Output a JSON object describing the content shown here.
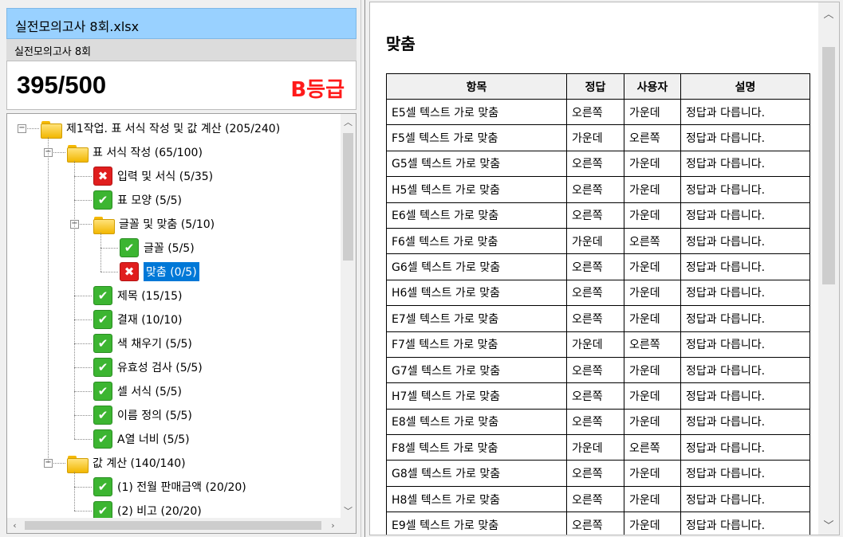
{
  "header": {
    "file_name": "실전모의고사 8회.xlsx",
    "exam_name": "실전모의고사 8회",
    "score": "395/500",
    "grade": "B등급"
  },
  "tree": [
    {
      "label": "제1작업. 표 서식 작성 및 값 계산 (205/240)",
      "icon": "folder-icon",
      "level": 0,
      "expander": "−"
    },
    {
      "label": "표 서식 작성 (65/100)",
      "icon": "folder-icon",
      "level": 1,
      "expander": "−"
    },
    {
      "label": "입력 및 서식 (5/35)",
      "icon": "fail-icon",
      "level": 2
    },
    {
      "label": "표 모양 (5/5)",
      "icon": "pass-icon",
      "level": 2
    },
    {
      "label": "글꼴 및 맞춤 (5/10)",
      "icon": "folder-icon",
      "level": 2,
      "expander": "−"
    },
    {
      "label": "글꼴 (5/5)",
      "icon": "pass-icon",
      "level": 3
    },
    {
      "label": "맞춤 (0/5)",
      "icon": "fail-icon",
      "level": 3,
      "selected": true
    },
    {
      "label": "제목 (15/15)",
      "icon": "pass-icon",
      "level": 2
    },
    {
      "label": "결재 (10/10)",
      "icon": "pass-icon",
      "level": 2
    },
    {
      "label": "색 채우기 (5/5)",
      "icon": "pass-icon",
      "level": 2
    },
    {
      "label": "유효성 검사 (5/5)",
      "icon": "pass-icon",
      "level": 2
    },
    {
      "label": "셀 서식 (5/5)",
      "icon": "pass-icon",
      "level": 2
    },
    {
      "label": "이름 정의 (5/5)",
      "icon": "pass-icon",
      "level": 2
    },
    {
      "label": "A열 너비 (5/5)",
      "icon": "pass-icon",
      "level": 2
    },
    {
      "label": "값 계산 (140/140)",
      "icon": "folder-icon",
      "level": 1,
      "expander": "−"
    },
    {
      "label": "(1) 전월 판매금액 (20/20)",
      "icon": "pass-icon",
      "level": 2
    },
    {
      "label": "(2) 비고 (20/20)",
      "icon": "pass-icon",
      "level": 2
    }
  ],
  "detail": {
    "title": "맞춤",
    "columns": [
      "항목",
      "정답",
      "사용자",
      "설명"
    ],
    "rows": [
      [
        "E5셀 텍스트 가로 맞춤",
        "오른쪽",
        "가운데",
        "정답과 다릅니다."
      ],
      [
        "F5셀 텍스트 가로 맞춤",
        "가운데",
        "오른쪽",
        "정답과 다릅니다."
      ],
      [
        "G5셀 텍스트 가로 맞춤",
        "오른쪽",
        "가운데",
        "정답과 다릅니다."
      ],
      [
        "H5셀 텍스트 가로 맞춤",
        "오른쪽",
        "가운데",
        "정답과 다릅니다."
      ],
      [
        "E6셀 텍스트 가로 맞춤",
        "오른쪽",
        "가운데",
        "정답과 다릅니다."
      ],
      [
        "F6셀 텍스트 가로 맞춤",
        "가운데",
        "오른쪽",
        "정답과 다릅니다."
      ],
      [
        "G6셀 텍스트 가로 맞춤",
        "오른쪽",
        "가운데",
        "정답과 다릅니다."
      ],
      [
        "H6셀 텍스트 가로 맞춤",
        "오른쪽",
        "가운데",
        "정답과 다릅니다."
      ],
      [
        "E7셀 텍스트 가로 맞춤",
        "오른쪽",
        "가운데",
        "정답과 다릅니다."
      ],
      [
        "F7셀 텍스트 가로 맞춤",
        "가운데",
        "오른쪽",
        "정답과 다릅니다."
      ],
      [
        "G7셀 텍스트 가로 맞춤",
        "오른쪽",
        "가운데",
        "정답과 다릅니다."
      ],
      [
        "H7셀 텍스트 가로 맞춤",
        "오른쪽",
        "가운데",
        "정답과 다릅니다."
      ],
      [
        "E8셀 텍스트 가로 맞춤",
        "오른쪽",
        "가운데",
        "정답과 다릅니다."
      ],
      [
        "F8셀 텍스트 가로 맞춤",
        "가운데",
        "오른쪽",
        "정답과 다릅니다."
      ],
      [
        "G8셀 텍스트 가로 맞춤",
        "오른쪽",
        "가운데",
        "정답과 다릅니다."
      ],
      [
        "H8셀 텍스트 가로 맞춤",
        "오른쪽",
        "가운데",
        "정답과 다릅니다."
      ],
      [
        "E9셀 텍스트 가로 맞춤",
        "오른쪽",
        "가운데",
        "정답과 다릅니다."
      ]
    ]
  }
}
